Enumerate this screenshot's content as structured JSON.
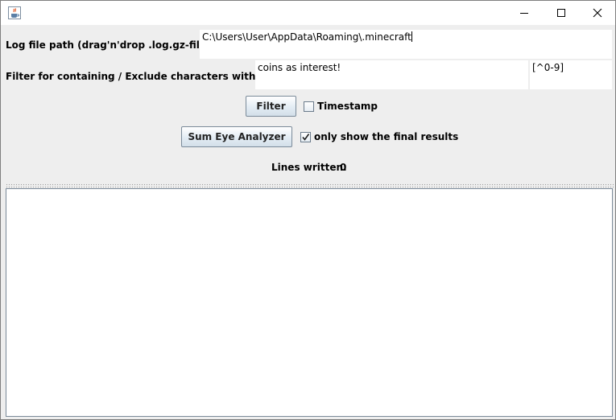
{
  "window": {
    "icon": "java-cup-icon",
    "controls": [
      "minimize-icon",
      "maximize-icon",
      "close-icon"
    ]
  },
  "form": {
    "log_path_label": "Log file path (drag'n'drop .log.gz-file here):",
    "log_path_value": "C:\\Users\\User\\AppData\\Roaming\\.minecraft",
    "filter_label": "Filter for containing / Exclude characters with a regex:",
    "filter_value": "coins as interest!",
    "exclude_regex_value": "[^0-9]",
    "filter_button": "Filter",
    "timestamp_label": "Timestamp",
    "timestamp_checked": false,
    "analyzer_button": "Sum Eye Analyzer",
    "final_results_label": "only show the final results",
    "final_results_checked": true,
    "lines_written_label": "Lines written:",
    "lines_written_value": "0"
  },
  "output": {
    "text": ""
  }
}
